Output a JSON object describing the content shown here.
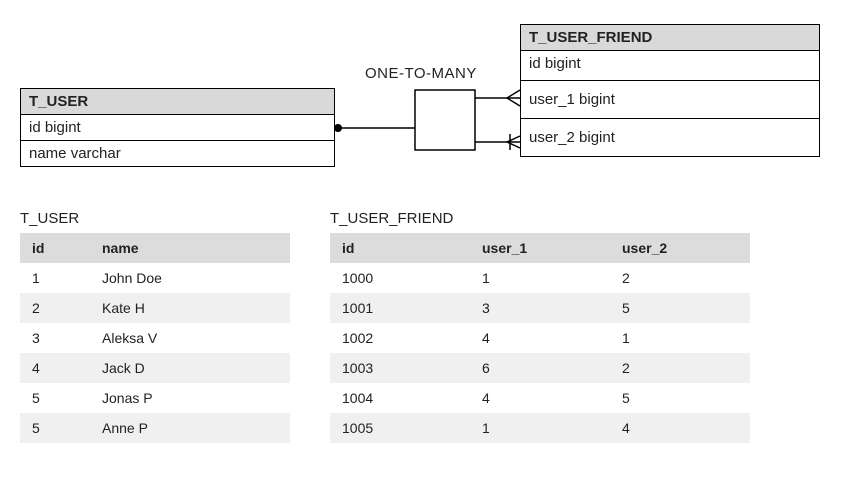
{
  "relationship_label": "ONE-TO-MANY",
  "entities": {
    "left": {
      "name": "T_USER",
      "columns": [
        "id bigint",
        "name varchar"
      ]
    },
    "right": {
      "name": "T_USER_FRIEND",
      "columns": [
        "id bigint",
        "user_1 bigint",
        "user_2 bigint"
      ]
    }
  },
  "data_tables": {
    "t_user": {
      "title": "T_USER",
      "headers": [
        "id",
        "name"
      ],
      "rows": [
        [
          "1",
          "John Doe"
        ],
        [
          "2",
          "Kate H"
        ],
        [
          "3",
          "Aleksa V"
        ],
        [
          "4",
          "Jack D"
        ],
        [
          "5",
          "Jonas P"
        ],
        [
          "5",
          "Anne P"
        ]
      ]
    },
    "t_user_friend": {
      "title": "T_USER_FRIEND",
      "headers": [
        "id",
        "user_1",
        "user_2"
      ],
      "rows": [
        [
          "1000",
          "1",
          "2"
        ],
        [
          "1001",
          "3",
          "5"
        ],
        [
          "1002",
          "4",
          "1"
        ],
        [
          "1003",
          "6",
          "2"
        ],
        [
          "1004",
          "4",
          "5"
        ],
        [
          "1005",
          "1",
          "4"
        ]
      ]
    }
  },
  "chart_data": {
    "type": "table",
    "erd": {
      "entities": [
        {
          "name": "T_USER",
          "columns": [
            {
              "name": "id",
              "type": "bigint"
            },
            {
              "name": "name",
              "type": "varchar"
            }
          ]
        },
        {
          "name": "T_USER_FRIEND",
          "columns": [
            {
              "name": "id",
              "type": "bigint"
            },
            {
              "name": "user_1",
              "type": "bigint"
            },
            {
              "name": "user_2",
              "type": "bigint"
            }
          ]
        }
      ],
      "relationships": [
        {
          "from_entity": "T_USER",
          "from_column": "id",
          "to_entity": "T_USER_FRIEND",
          "to_column": "user_1",
          "cardinality": "one-to-many"
        },
        {
          "from_entity": "T_USER",
          "from_column": "id",
          "to_entity": "T_USER_FRIEND",
          "to_column": "user_2",
          "cardinality": "one-to-many"
        }
      ]
    },
    "t_user": [
      {
        "id": 1,
        "name": "John Doe"
      },
      {
        "id": 2,
        "name": "Kate H"
      },
      {
        "id": 3,
        "name": "Aleksa V"
      },
      {
        "id": 4,
        "name": "Jack D"
      },
      {
        "id": 5,
        "name": "Jonas P"
      },
      {
        "id": 5,
        "name": "Anne P"
      }
    ],
    "t_user_friend": [
      {
        "id": 1000,
        "user_1": 1,
        "user_2": 2
      },
      {
        "id": 1001,
        "user_1": 3,
        "user_2": 5
      },
      {
        "id": 1002,
        "user_1": 4,
        "user_2": 1
      },
      {
        "id": 1003,
        "user_1": 6,
        "user_2": 2
      },
      {
        "id": 1004,
        "user_1": 4,
        "user_2": 5
      },
      {
        "id": 1005,
        "user_1": 1,
        "user_2": 4
      }
    ]
  }
}
